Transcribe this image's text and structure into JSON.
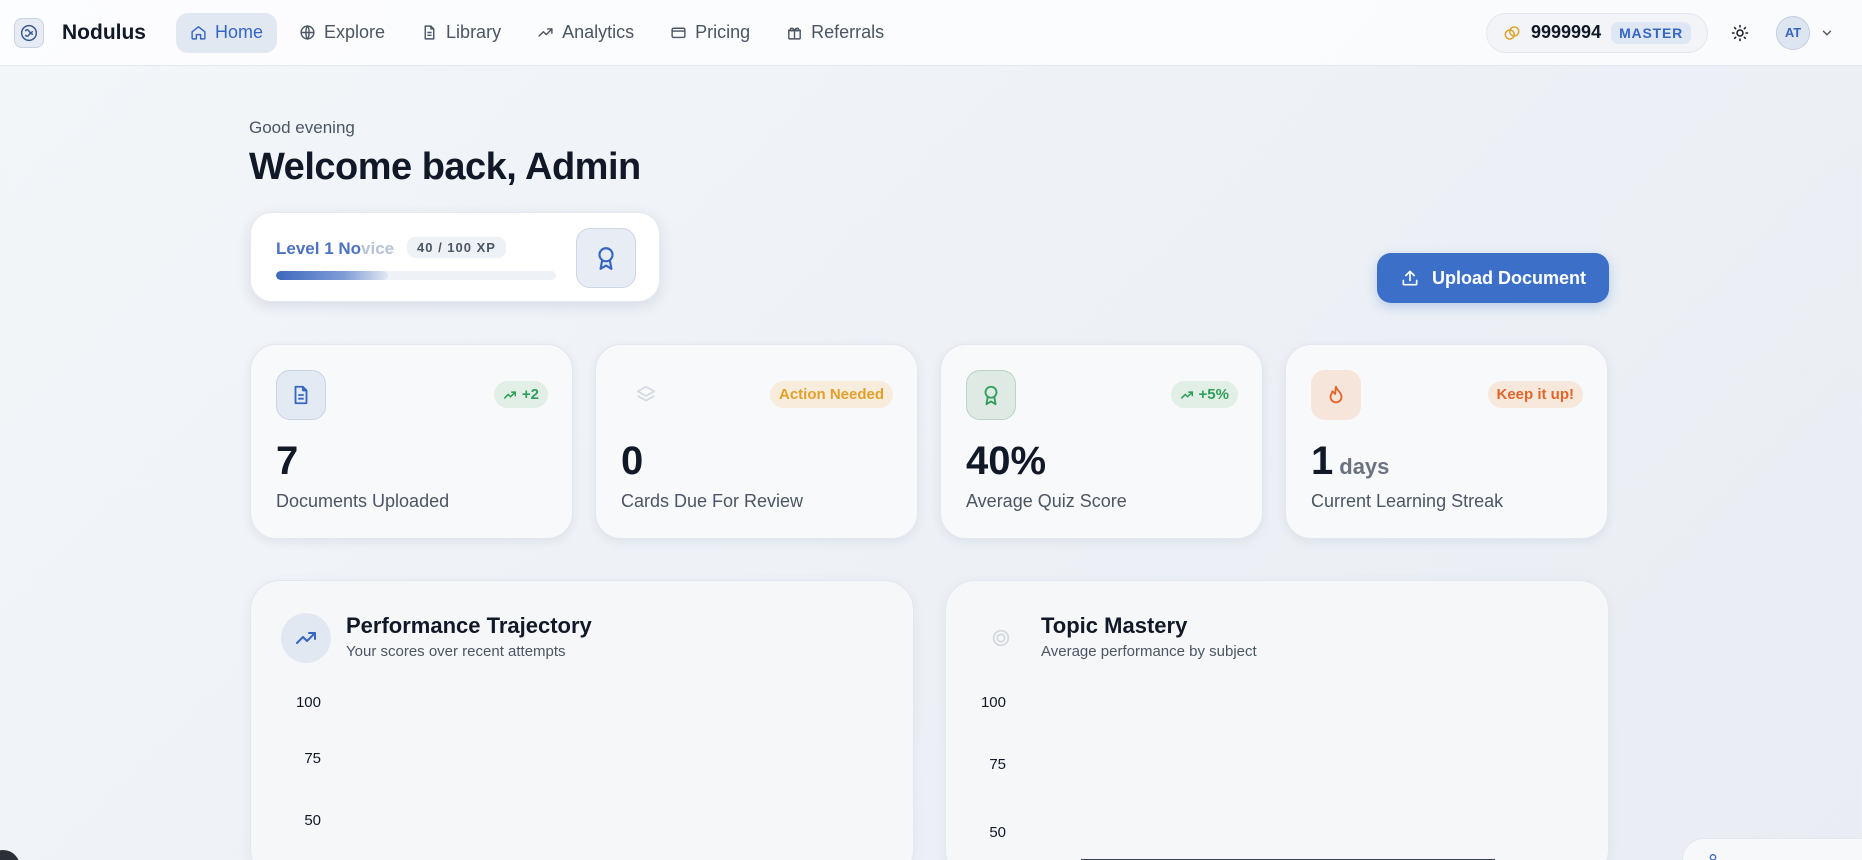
{
  "brand": {
    "name": "Nodulus"
  },
  "nav": {
    "items": [
      {
        "label": "Home",
        "icon": "home-icon",
        "active": true
      },
      {
        "label": "Explore",
        "icon": "globe-icon",
        "active": false
      },
      {
        "label": "Library",
        "icon": "document-icon",
        "active": false
      },
      {
        "label": "Analytics",
        "icon": "trend-up-icon",
        "active": false
      },
      {
        "label": "Pricing",
        "icon": "credit-card-icon",
        "active": false
      },
      {
        "label": "Referrals",
        "icon": "gift-icon",
        "active": false
      }
    ]
  },
  "account": {
    "credits": "9999994",
    "tier": "MASTER",
    "avatar_initials": "AT"
  },
  "header": {
    "greeting": "Good evening",
    "welcome": "Welcome back, Admin"
  },
  "level": {
    "title_main": "Level 1 No",
    "title_fade": "vice",
    "xp_text": "40 / 100 XP",
    "xp_progress": 0.4
  },
  "actions": {
    "upload_label": "Upload Document"
  },
  "stats": [
    {
      "icon": "document-icon",
      "tag": "+2",
      "tag_icon": "trend-up-icon",
      "value": "7",
      "unit": "",
      "label": "Documents Uploaded"
    },
    {
      "icon": "layers-icon",
      "tag": "Action Needed",
      "tag_icon": "",
      "value": "0",
      "unit": "",
      "label": "Cards Due For Review"
    },
    {
      "icon": "award-icon",
      "tag": "+5%",
      "tag_icon": "trend-up-icon",
      "value": "40%",
      "unit": "",
      "label": "Average Quiz Score"
    },
    {
      "icon": "flame-icon",
      "tag": "Keep it up!",
      "tag_icon": "",
      "value": "1",
      "unit": "days",
      "label": "Current Learning Streak"
    }
  ],
  "panels": [
    {
      "title": "Performance Trajectory",
      "subtitle": "Your scores over recent attempts",
      "icon": "trend-up-icon",
      "yticks": [
        "100",
        "75",
        "50"
      ]
    },
    {
      "title": "Topic Mastery",
      "subtitle": "Average performance by subject",
      "icon": "target-icon",
      "yticks": [
        "100",
        "75",
        "50"
      ]
    }
  ],
  "colors": {
    "accent": "#3b6fc8",
    "success": "#2f9e5a",
    "warning": "#e3a02a",
    "streak": "#e2662a"
  }
}
